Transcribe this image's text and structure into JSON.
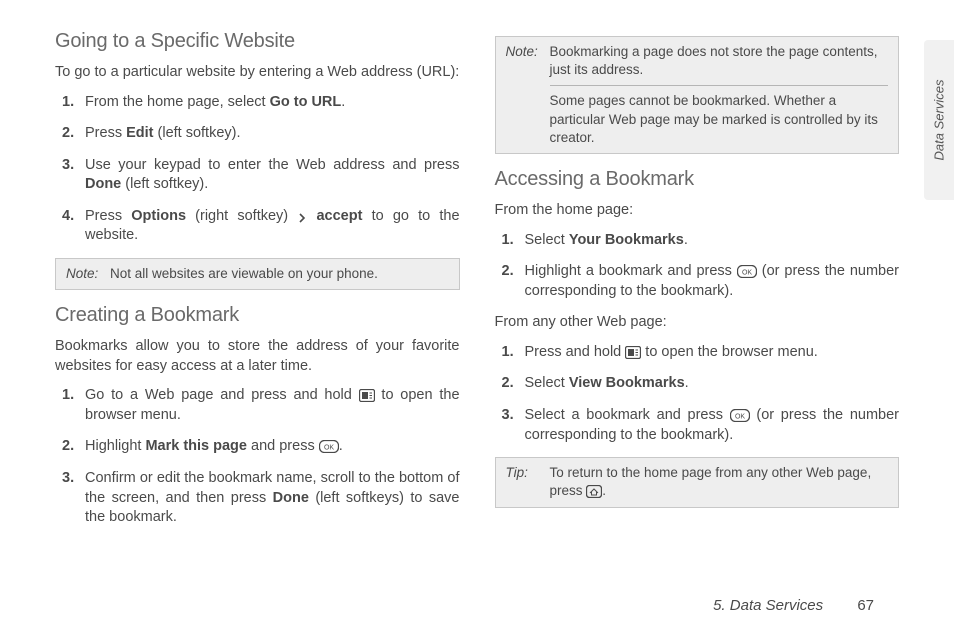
{
  "side_tab": "Data Services",
  "footer": {
    "chapter": "5. Data Services",
    "page": "67"
  },
  "left": {
    "h1": "Going to a Specific Website",
    "intro": "To go to a particular website by entering a Web address (URL):",
    "list1": {
      "i1a": "From the home page, select ",
      "i1b": "Go to URL",
      "i1c": ".",
      "i2a": "Press ",
      "i2b": "Edit",
      "i2c": " (left softkey).",
      "i3a": "Use your keypad to enter the Web address and press ",
      "i3b": "Done",
      "i3c": " (left softkey).",
      "i4a": "Press ",
      "i4b": "Options",
      "i4c": " (right softkey) ",
      "i4d": "accept",
      "i4e": " to go to the website."
    },
    "note1": {
      "label": "Note:",
      "body": "Not all websites are viewable on your phone."
    },
    "h2": "Creating a Bookmark",
    "p2": "Bookmarks allow you to store the address of your favorite websites for easy access at a later time.",
    "list2": {
      "i1a": "Go to a Web page and press and hold ",
      "i1b": " to open the browser menu.",
      "i2a": "Highlight ",
      "i2b": "Mark this page",
      "i2c": " and press ",
      "i2d": ".",
      "i3a": "Confirm or edit the bookmark name, scroll to the bottom of the screen, and then press ",
      "i3b": "Done",
      "i3c": " (left softkeys) to save the bookmark."
    }
  },
  "right": {
    "note2": {
      "label": "Note:",
      "body1": "Bookmarking a page does not store the page contents, just its address.",
      "body2": "Some pages cannot be bookmarked. Whether a particular Web page may be marked is controlled by its creator."
    },
    "h3": "Accessing a Bookmark",
    "p3": "From the home page:",
    "list3": {
      "i1a": "Select ",
      "i1b": "Your Bookmarks",
      "i1c": ".",
      "i2a": "Highlight a bookmark and press ",
      "i2b": " (or press the number corresponding to the bookmark)."
    },
    "p4": "From any other Web page:",
    "list4": {
      "i1a": "Press and hold ",
      "i1b": " to open the browser menu.",
      "i2a": "Select ",
      "i2b": "View Bookmarks",
      "i2c": ".",
      "i3a": "Select a bookmark and press ",
      "i3b": " (or press the number corresponding to the bookmark)."
    },
    "tip": {
      "label": "Tip:",
      "body1": "To return to the home page from any other Web page, press ",
      "body2": "."
    }
  }
}
